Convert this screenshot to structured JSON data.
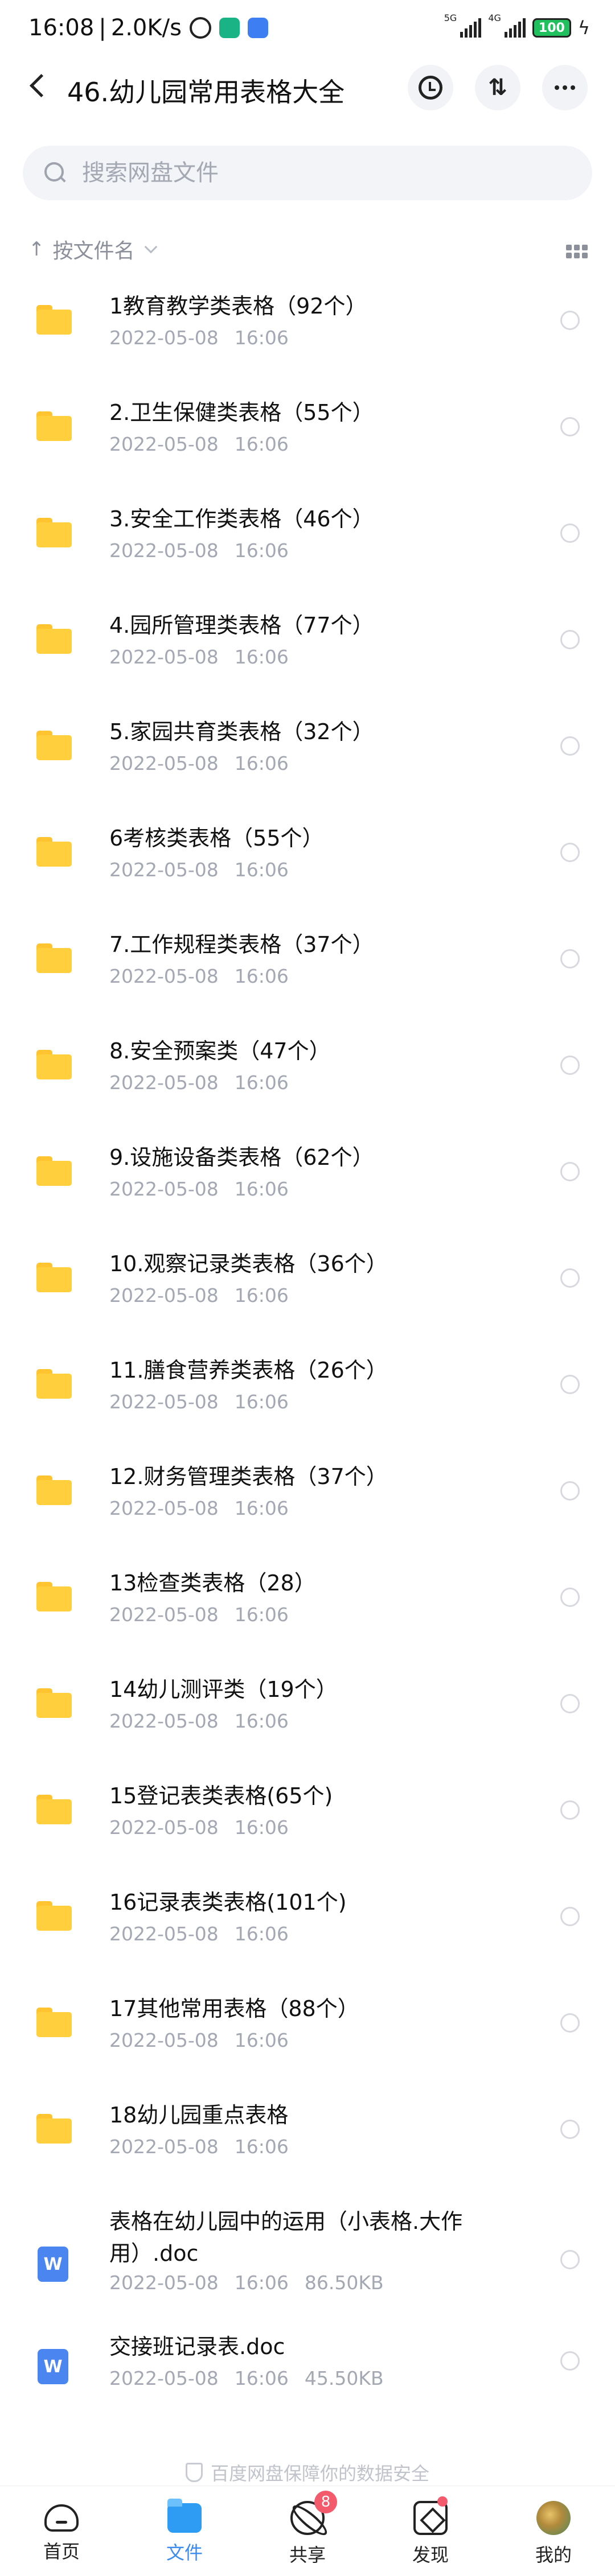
{
  "status_bar": {
    "time": "16:08",
    "separator": "|",
    "speed": "2.0K/s",
    "battery": "100",
    "signal1_label": "5G",
    "signal2_label": "4G"
  },
  "header": {
    "title": "46.幼儿园常用表格大全",
    "sort_icon_text": "⇅"
  },
  "search": {
    "placeholder": "搜索网盘文件"
  },
  "sort": {
    "label": "按文件名"
  },
  "files": [
    {
      "name": "1教育教学类表格（92个）",
      "date": "2022-05-08",
      "time": "16:06",
      "size": "",
      "type": "folder"
    },
    {
      "name": "2.卫生保健类表格（55个）",
      "date": "2022-05-08",
      "time": "16:06",
      "size": "",
      "type": "folder"
    },
    {
      "name": "3.安全工作类表格（46个）",
      "date": "2022-05-08",
      "time": "16:06",
      "size": "",
      "type": "folder"
    },
    {
      "name": "4.园所管理类表格（77个）",
      "date": "2022-05-08",
      "time": "16:06",
      "size": "",
      "type": "folder"
    },
    {
      "name": "5.家园共育类表格（32个）",
      "date": "2022-05-08",
      "time": "16:06",
      "size": "",
      "type": "folder"
    },
    {
      "name": "6考核类表格（55个）",
      "date": "2022-05-08",
      "time": "16:06",
      "size": "",
      "type": "folder"
    },
    {
      "name": "7.工作规程类表格（37个）",
      "date": "2022-05-08",
      "time": "16:06",
      "size": "",
      "type": "folder"
    },
    {
      "name": "8.安全预案类（47个）",
      "date": "2022-05-08",
      "time": "16:06",
      "size": "",
      "type": "folder"
    },
    {
      "name": "9.设施设备类表格（62个）",
      "date": "2022-05-08",
      "time": "16:06",
      "size": "",
      "type": "folder"
    },
    {
      "name": "10.观察记录类表格（36个）",
      "date": "2022-05-08",
      "time": "16:06",
      "size": "",
      "type": "folder"
    },
    {
      "name": "11.膳食营养类表格（26个）",
      "date": "2022-05-08",
      "time": "16:06",
      "size": "",
      "type": "folder"
    },
    {
      "name": "12.财务管理类表格（37个）",
      "date": "2022-05-08",
      "time": "16:06",
      "size": "",
      "type": "folder"
    },
    {
      "name": "13检查类表格（28）",
      "date": "2022-05-08",
      "time": "16:06",
      "size": "",
      "type": "folder"
    },
    {
      "name": "14幼儿测评类（19个）",
      "date": "2022-05-08",
      "time": "16:06",
      "size": "",
      "type": "folder"
    },
    {
      "name": "15登记表类表格(65个)",
      "date": "2022-05-08",
      "time": "16:06",
      "size": "",
      "type": "folder"
    },
    {
      "name": "16记录表类表格(101个)",
      "date": "2022-05-08",
      "time": "16:06",
      "size": "",
      "type": "folder"
    },
    {
      "name": "17其他常用表格（88个）",
      "date": "2022-05-08",
      "time": "16:06",
      "size": "",
      "type": "folder"
    },
    {
      "name": "18幼儿园重点表格",
      "date": "2022-05-08",
      "time": "16:06",
      "size": "",
      "type": "folder"
    },
    {
      "name": "表格在幼儿园中的运用（小表格.大作用）.doc",
      "date": "2022-05-08",
      "time": "16:06",
      "size": "86.50KB",
      "type": "doc"
    },
    {
      "name": "交接班记录表.doc",
      "date": "2022-05-08",
      "time": "16:06",
      "size": "45.50KB",
      "type": "doc"
    }
  ],
  "doc_icon_letter": "W",
  "footer_note": "百度网盘保障你的数据安全",
  "nav": [
    {
      "label": "首页",
      "icon": "home-icon",
      "active": false
    },
    {
      "label": "文件",
      "icon": "files-icon",
      "active": true
    },
    {
      "label": "共享",
      "icon": "share-icon",
      "active": false,
      "badge": "8"
    },
    {
      "label": "发现",
      "icon": "discover-icon",
      "active": false
    },
    {
      "label": "我的",
      "icon": "avatar-icon",
      "active": false
    }
  ],
  "colors": {
    "folder": "#ffcf3d",
    "doc": "#4b86f0",
    "accent": "#3a8cf0",
    "badge": "#f35a6b"
  }
}
